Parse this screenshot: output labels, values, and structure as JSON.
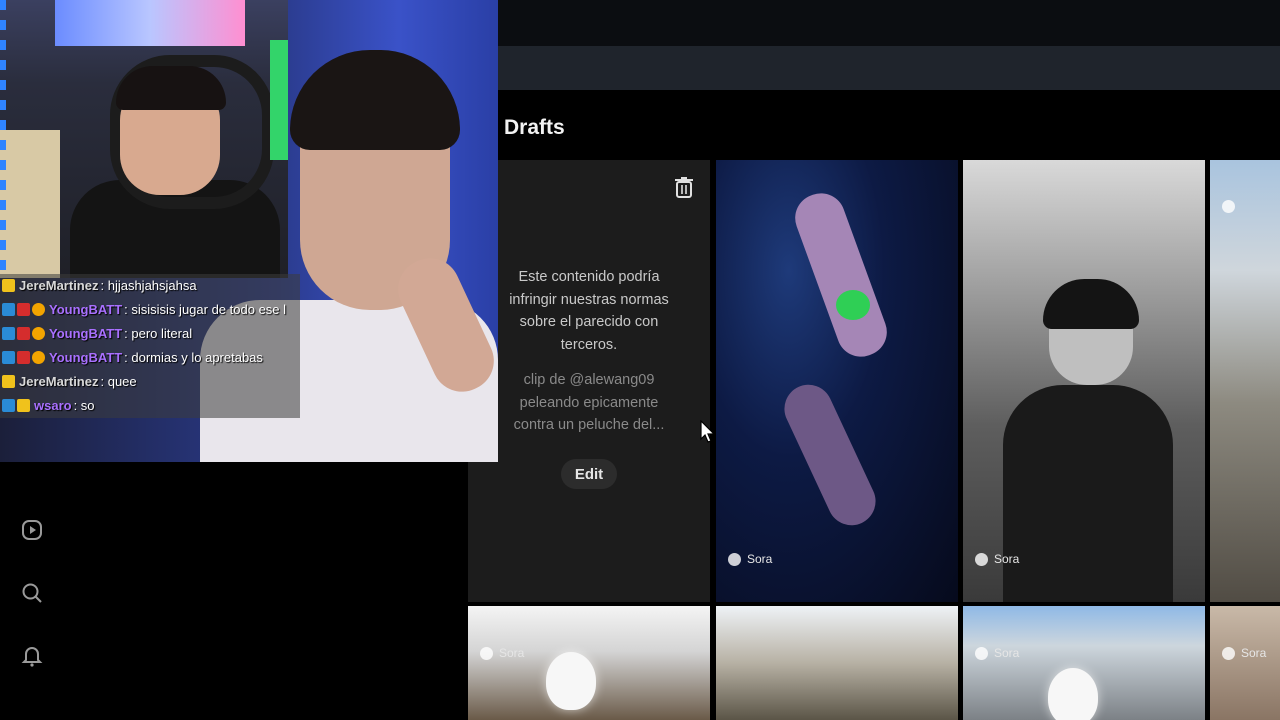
{
  "drafts": {
    "title": "Drafts",
    "warning_text": "Este contenido podría infringir nuestras normas sobre el parecido con terceros.",
    "prompt_text": "clip de @alewang09 peleando epicamente contra un peluche del...",
    "edit_label": "Edit",
    "sora_label": "Sora"
  },
  "sidebar": {
    "items": [
      {
        "icon": "play-icon"
      },
      {
        "icon": "search-icon"
      },
      {
        "icon": "bell-icon"
      }
    ]
  },
  "chat": {
    "messages": [
      {
        "badges": [
          "crown"
        ],
        "user": "JereMartinez",
        "color": "#d9d9d9",
        "text": "hjjashjahsjahsa"
      },
      {
        "badges": [
          "prime",
          "vip",
          "bits"
        ],
        "user": "YoungBATT",
        "color": "#a970ff",
        "text": "sisisisis jugar de todo ese l"
      },
      {
        "badges": [
          "prime",
          "vip",
          "bits"
        ],
        "user": "YoungBATT",
        "color": "#a970ff",
        "text": "pero literal"
      },
      {
        "badges": [
          "prime",
          "vip",
          "bits"
        ],
        "user": "YoungBATT",
        "color": "#a970ff",
        "text": "dormias y lo apretabas"
      },
      {
        "badges": [
          "crown"
        ],
        "user": "JereMartinez",
        "color": "#d9d9d9",
        "text": "quee"
      },
      {
        "badges": [
          "prime",
          "crown"
        ],
        "user": "wsaro",
        "color": "#a970ff",
        "text": "so"
      }
    ]
  },
  "colors": {
    "background": "#000000",
    "card": "#1c1c1c",
    "searchbar": "#1f242c"
  }
}
